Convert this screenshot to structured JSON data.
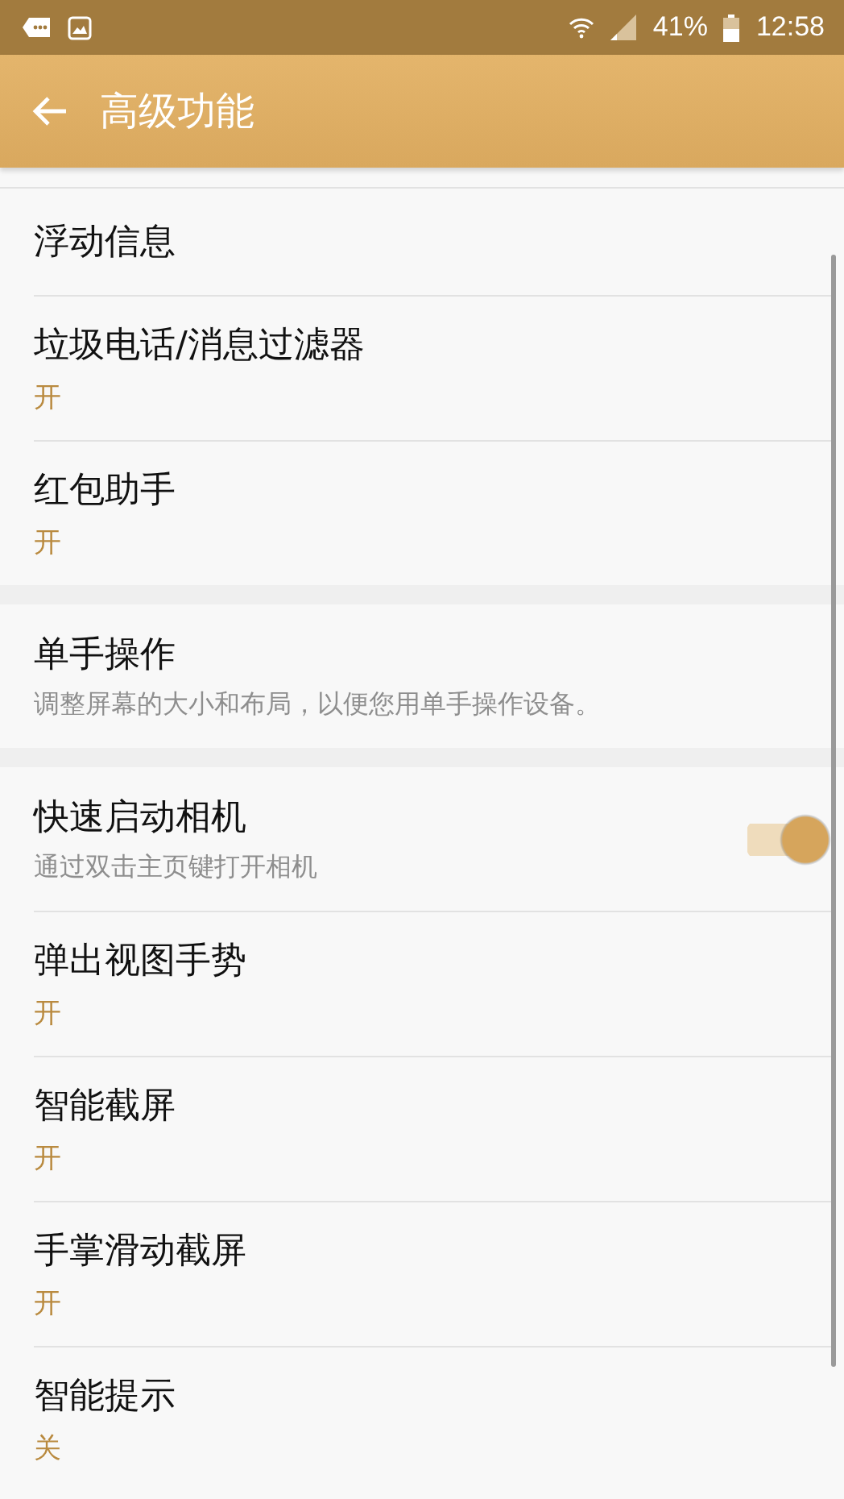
{
  "status_bar": {
    "battery_text": "41%",
    "time": "12:58"
  },
  "app_bar": {
    "title": "高级功能"
  },
  "sections": [
    {
      "items": [
        {
          "kind": "plain",
          "title": "浮动信息"
        },
        {
          "kind": "status",
          "title": "垃圾电话/消息过滤器",
          "subtitle": "开"
        },
        {
          "kind": "status",
          "title": "红包助手",
          "subtitle": "开"
        }
      ]
    },
    {
      "items": [
        {
          "kind": "description",
          "title": "单手操作",
          "subtitle": "调整屏幕的大小和布局，以便您用单手操作设备。"
        }
      ]
    },
    {
      "items": [
        {
          "kind": "toggle",
          "title": "快速启动相机",
          "subtitle": "通过双击主页键打开相机",
          "on": true
        },
        {
          "kind": "status",
          "title": "弹出视图手势",
          "subtitle": "开"
        },
        {
          "kind": "status",
          "title": "智能截屏",
          "subtitle": "开"
        },
        {
          "kind": "status",
          "title": "手掌滑动截屏",
          "subtitle": "开"
        },
        {
          "kind": "status",
          "title": "智能提示",
          "subtitle": "关"
        }
      ]
    }
  ]
}
